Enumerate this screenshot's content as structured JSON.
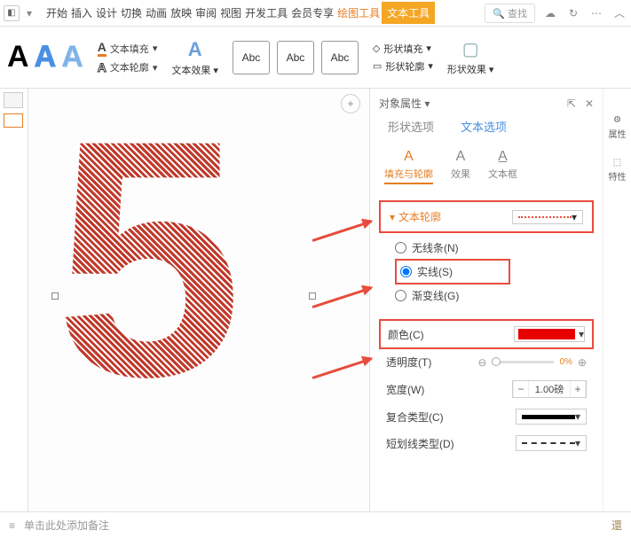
{
  "topbar": {
    "menus": [
      "开始",
      "插入",
      "设计",
      "切换",
      "动画",
      "放映",
      "审阅",
      "视图",
      "开发工具",
      "会员专享"
    ],
    "tool1": "绘图工具",
    "tool2": "文本工具",
    "search": "查找"
  },
  "ribbon": {
    "textFill": "文本填充",
    "textOutline": "文本轮廓",
    "textEffect": "文本效果",
    "abc": "Abc",
    "shapeFill": "形状填充",
    "shapeOutline": "形状轮廓",
    "shapeEffect": "形状效果"
  },
  "panel": {
    "header": "对象属性",
    "tabs": {
      "shape": "形状选项",
      "text": "文本选项"
    },
    "subtabs": {
      "fill": "填充与轮廓",
      "effect": "效果",
      "textbox": "文本框"
    },
    "side": {
      "prop": "属性",
      "feat": "特性"
    },
    "textOutline": "文本轮廓",
    "lineOptions": {
      "none": "无线条(N)",
      "solid": "实线(S)",
      "gradient": "渐变线(G)"
    },
    "colorLabel": "颜色(C)",
    "opacityLabel": "透明度(T)",
    "opacityValue": "0%",
    "widthLabel": "宽度(W)",
    "widthValue": "1.00磅",
    "compoundLabel": "复合类型(C)",
    "dashLabel": "短划线类型(D)"
  },
  "footer": {
    "notes": "单击此处添加备注",
    "right": "還"
  }
}
